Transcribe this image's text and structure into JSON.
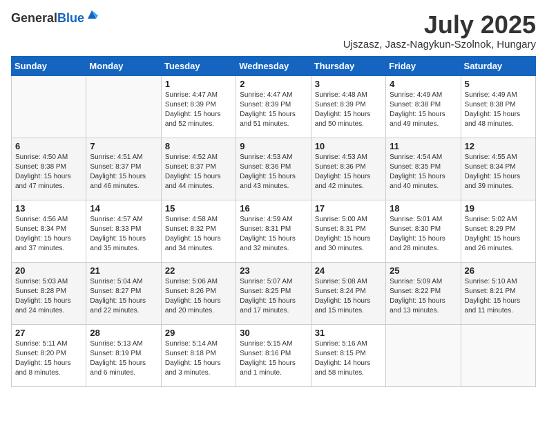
{
  "header": {
    "logo_general": "General",
    "logo_blue": "Blue",
    "month": "July 2025",
    "location": "Ujszasz, Jasz-Nagykun-Szolnok, Hungary"
  },
  "weekdays": [
    "Sunday",
    "Monday",
    "Tuesday",
    "Wednesday",
    "Thursday",
    "Friday",
    "Saturday"
  ],
  "weeks": [
    [
      {
        "day": "",
        "sunrise": "",
        "sunset": "",
        "daylight": ""
      },
      {
        "day": "",
        "sunrise": "",
        "sunset": "",
        "daylight": ""
      },
      {
        "day": "1",
        "sunrise": "Sunrise: 4:47 AM",
        "sunset": "Sunset: 8:39 PM",
        "daylight": "Daylight: 15 hours and 52 minutes."
      },
      {
        "day": "2",
        "sunrise": "Sunrise: 4:47 AM",
        "sunset": "Sunset: 8:39 PM",
        "daylight": "Daylight: 15 hours and 51 minutes."
      },
      {
        "day": "3",
        "sunrise": "Sunrise: 4:48 AM",
        "sunset": "Sunset: 8:39 PM",
        "daylight": "Daylight: 15 hours and 50 minutes."
      },
      {
        "day": "4",
        "sunrise": "Sunrise: 4:49 AM",
        "sunset": "Sunset: 8:38 PM",
        "daylight": "Daylight: 15 hours and 49 minutes."
      },
      {
        "day": "5",
        "sunrise": "Sunrise: 4:49 AM",
        "sunset": "Sunset: 8:38 PM",
        "daylight": "Daylight: 15 hours and 48 minutes."
      }
    ],
    [
      {
        "day": "6",
        "sunrise": "Sunrise: 4:50 AM",
        "sunset": "Sunset: 8:38 PM",
        "daylight": "Daylight: 15 hours and 47 minutes."
      },
      {
        "day": "7",
        "sunrise": "Sunrise: 4:51 AM",
        "sunset": "Sunset: 8:37 PM",
        "daylight": "Daylight: 15 hours and 46 minutes."
      },
      {
        "day": "8",
        "sunrise": "Sunrise: 4:52 AM",
        "sunset": "Sunset: 8:37 PM",
        "daylight": "Daylight: 15 hours and 44 minutes."
      },
      {
        "day": "9",
        "sunrise": "Sunrise: 4:53 AM",
        "sunset": "Sunset: 8:36 PM",
        "daylight": "Daylight: 15 hours and 43 minutes."
      },
      {
        "day": "10",
        "sunrise": "Sunrise: 4:53 AM",
        "sunset": "Sunset: 8:36 PM",
        "daylight": "Daylight: 15 hours and 42 minutes."
      },
      {
        "day": "11",
        "sunrise": "Sunrise: 4:54 AM",
        "sunset": "Sunset: 8:35 PM",
        "daylight": "Daylight: 15 hours and 40 minutes."
      },
      {
        "day": "12",
        "sunrise": "Sunrise: 4:55 AM",
        "sunset": "Sunset: 8:34 PM",
        "daylight": "Daylight: 15 hours and 39 minutes."
      }
    ],
    [
      {
        "day": "13",
        "sunrise": "Sunrise: 4:56 AM",
        "sunset": "Sunset: 8:34 PM",
        "daylight": "Daylight: 15 hours and 37 minutes."
      },
      {
        "day": "14",
        "sunrise": "Sunrise: 4:57 AM",
        "sunset": "Sunset: 8:33 PM",
        "daylight": "Daylight: 15 hours and 35 minutes."
      },
      {
        "day": "15",
        "sunrise": "Sunrise: 4:58 AM",
        "sunset": "Sunset: 8:32 PM",
        "daylight": "Daylight: 15 hours and 34 minutes."
      },
      {
        "day": "16",
        "sunrise": "Sunrise: 4:59 AM",
        "sunset": "Sunset: 8:31 PM",
        "daylight": "Daylight: 15 hours and 32 minutes."
      },
      {
        "day": "17",
        "sunrise": "Sunrise: 5:00 AM",
        "sunset": "Sunset: 8:31 PM",
        "daylight": "Daylight: 15 hours and 30 minutes."
      },
      {
        "day": "18",
        "sunrise": "Sunrise: 5:01 AM",
        "sunset": "Sunset: 8:30 PM",
        "daylight": "Daylight: 15 hours and 28 minutes."
      },
      {
        "day": "19",
        "sunrise": "Sunrise: 5:02 AM",
        "sunset": "Sunset: 8:29 PM",
        "daylight": "Daylight: 15 hours and 26 minutes."
      }
    ],
    [
      {
        "day": "20",
        "sunrise": "Sunrise: 5:03 AM",
        "sunset": "Sunset: 8:28 PM",
        "daylight": "Daylight: 15 hours and 24 minutes."
      },
      {
        "day": "21",
        "sunrise": "Sunrise: 5:04 AM",
        "sunset": "Sunset: 8:27 PM",
        "daylight": "Daylight: 15 hours and 22 minutes."
      },
      {
        "day": "22",
        "sunrise": "Sunrise: 5:06 AM",
        "sunset": "Sunset: 8:26 PM",
        "daylight": "Daylight: 15 hours and 20 minutes."
      },
      {
        "day": "23",
        "sunrise": "Sunrise: 5:07 AM",
        "sunset": "Sunset: 8:25 PM",
        "daylight": "Daylight: 15 hours and 17 minutes."
      },
      {
        "day": "24",
        "sunrise": "Sunrise: 5:08 AM",
        "sunset": "Sunset: 8:24 PM",
        "daylight": "Daylight: 15 hours and 15 minutes."
      },
      {
        "day": "25",
        "sunrise": "Sunrise: 5:09 AM",
        "sunset": "Sunset: 8:22 PM",
        "daylight": "Daylight: 15 hours and 13 minutes."
      },
      {
        "day": "26",
        "sunrise": "Sunrise: 5:10 AM",
        "sunset": "Sunset: 8:21 PM",
        "daylight": "Daylight: 15 hours and 11 minutes."
      }
    ],
    [
      {
        "day": "27",
        "sunrise": "Sunrise: 5:11 AM",
        "sunset": "Sunset: 8:20 PM",
        "daylight": "Daylight: 15 hours and 8 minutes."
      },
      {
        "day": "28",
        "sunrise": "Sunrise: 5:13 AM",
        "sunset": "Sunset: 8:19 PM",
        "daylight": "Daylight: 15 hours and 6 minutes."
      },
      {
        "day": "29",
        "sunrise": "Sunrise: 5:14 AM",
        "sunset": "Sunset: 8:18 PM",
        "daylight": "Daylight: 15 hours and 3 minutes."
      },
      {
        "day": "30",
        "sunrise": "Sunrise: 5:15 AM",
        "sunset": "Sunset: 8:16 PM",
        "daylight": "Daylight: 15 hours and 1 minute."
      },
      {
        "day": "31",
        "sunrise": "Sunrise: 5:16 AM",
        "sunset": "Sunset: 8:15 PM",
        "daylight": "Daylight: 14 hours and 58 minutes."
      },
      {
        "day": "",
        "sunrise": "",
        "sunset": "",
        "daylight": ""
      },
      {
        "day": "",
        "sunrise": "",
        "sunset": "",
        "daylight": ""
      }
    ]
  ]
}
